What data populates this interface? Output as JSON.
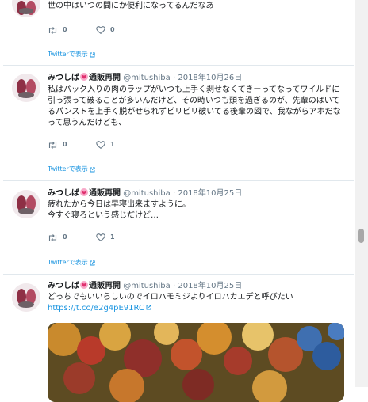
{
  "tweets": [
    {
      "text": "世の中はいつの間にか便利になってるんだなあ",
      "retweets": "0",
      "likes": "0",
      "view_link": "Twitterで表示"
    },
    {
      "name_prefix": "みつしば",
      "name_suffix": "通販再開",
      "handle": "@mitushiba",
      "separator": "·",
      "date": "2018年10月26日",
      "text": "私はパック入りの肉のラップがいつも上手く剥せなくてきーってなってワイルドに引っ張って破ることが多いんだけど、その時いつも頭を過ぎるのが、先輩のはいてるパンストを上手く脱がせられずビリビリ破いてる後輩の図で、我ながらアホだなって思うんだけども、",
      "retweets": "0",
      "likes": "1",
      "view_link": "Twitterで表示"
    },
    {
      "name_prefix": "みつしば",
      "name_suffix": "通販再開",
      "handle": "@mitushiba",
      "separator": "·",
      "date": "2018年10月25日",
      "text": "疲れたから今日は早寝出来ますように。\n今すぐ寝ろという感じだけど…",
      "retweets": "0",
      "likes": "1",
      "view_link": "Twitterで表示"
    },
    {
      "name_prefix": "みつしば",
      "name_suffix": "通販再開",
      "handle": "@mitushiba",
      "separator": "·",
      "date": "2018年10月25日",
      "text": "どっちでもいいらしいのでイロハモミジよりイロハカエデと呼びたい",
      "link": "https://t.co/e2g4pE91RC"
    }
  ],
  "colors": {
    "link": "#1b95e0",
    "muted": "#657786",
    "divider": "#e1e8ed"
  },
  "icons": [
    "retweet-icon",
    "heart-outline-icon",
    "external-link-icon",
    "pink-heart-emoji"
  ]
}
